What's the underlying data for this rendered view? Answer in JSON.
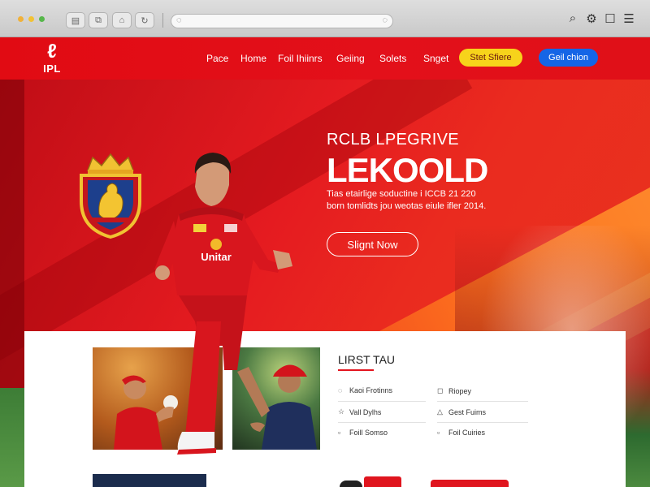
{
  "browser": {
    "toolbar_icons": [
      "sidebar-icon",
      "tabs-icon",
      "home-icon",
      "share-icon"
    ],
    "right_icons": [
      "search-icon",
      "settings-icon",
      "bookmark-icon",
      "menu-icon"
    ]
  },
  "nav": {
    "logo_text": "IPL",
    "items": [
      "Pace",
      "Home",
      "Foil Ihiinrs",
      "Geiing",
      "Solets",
      "Snget"
    ],
    "primary_cta": "Stet Sfiere",
    "secondary_cta": "Geil chion"
  },
  "hero": {
    "kicker": "RCLB LPEGRIVE",
    "title": "LEKOOLD",
    "description_line1": "Tias etairlige soductine i ICCB 21 220",
    "description_line2": "born tomlidts jou weotas eiule ifler 2014.",
    "cta": "Slignt Now",
    "jersey_text": "Unitar"
  },
  "list": {
    "title": "LIRST TAU",
    "items": [
      {
        "icon": "pin-icon",
        "label": "Kaoi Frotinns"
      },
      {
        "icon": "doc-icon",
        "label": "Riopey"
      },
      {
        "icon": "star-icon",
        "label": "Vall Dylhs"
      },
      {
        "icon": "bell-icon",
        "label": "Gest Fuims"
      },
      {
        "icon": "calendar-icon",
        "label": "Foill Somso"
      },
      {
        "icon": "calendar-icon",
        "label": "Foil Cuiries"
      }
    ]
  },
  "colors": {
    "brand_red": "#e10b13",
    "cta_yellow": "#f7d31b",
    "cta_blue": "#1565e6",
    "accent_orange": "#f5811f"
  }
}
